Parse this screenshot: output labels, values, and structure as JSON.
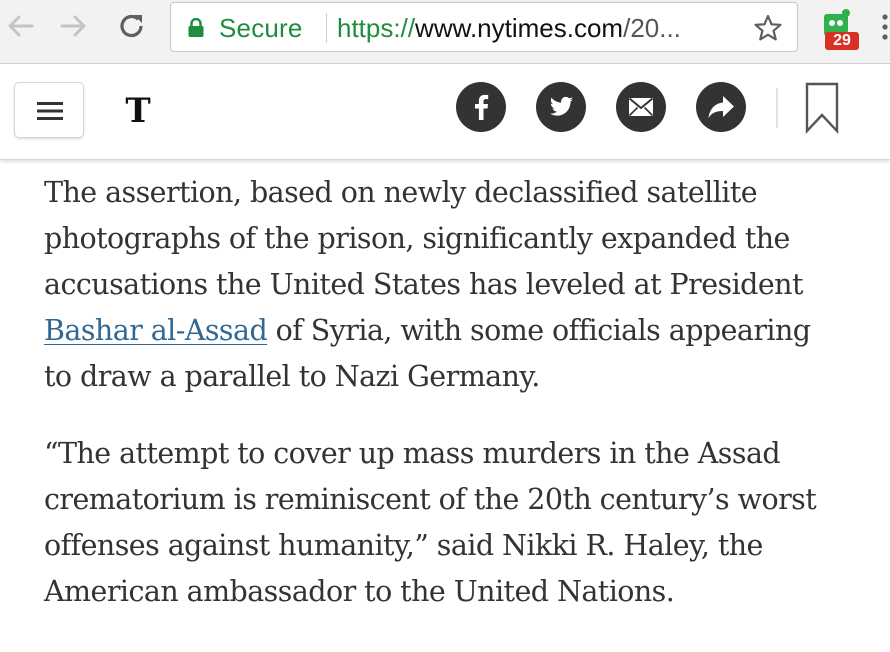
{
  "browser": {
    "secure_label": "Secure",
    "url_scheme": "https://",
    "url_host": "www.nytimes.com",
    "url_path": "/20...",
    "extension_badge": "29"
  },
  "toolbar": {
    "logo": "T"
  },
  "article": {
    "paragraph1": {
      "lines": [
        "The assertion, based on newly declassified satellite",
        "photographs of the prison, significantly expanded the",
        "accusations the United States has leveled at President"
      ],
      "link_text": "Bashar al-Assad",
      "after_link": " of Syria, with some officials appearing",
      "last_line": "to draw a parallel to Nazi Germany."
    },
    "paragraph2": {
      "lines": [
        "“The attempt to cover up mass murders in the Assad",
        "crematorium is reminiscent of the 20th century’s worst",
        "offenses against humanity,” said Nikki R. Haley, the",
        "American ambassador to the United Nations."
      ]
    }
  },
  "colors": {
    "secure_green": "#1e8e3e",
    "link_blue": "#326891",
    "share_button": "#333333",
    "badge_red": "#d93025"
  },
  "icons": {
    "back": "back-arrow-icon",
    "forward": "forward-arrow-icon",
    "reload": "reload-icon",
    "lock": "lock-icon",
    "star": "star-icon",
    "extension": "extension-icon",
    "menu": "hamburger-icon",
    "facebook": "facebook-icon",
    "twitter": "twitter-icon",
    "email": "email-icon",
    "share": "share-arrow-icon",
    "bookmark": "bookmark-icon"
  }
}
